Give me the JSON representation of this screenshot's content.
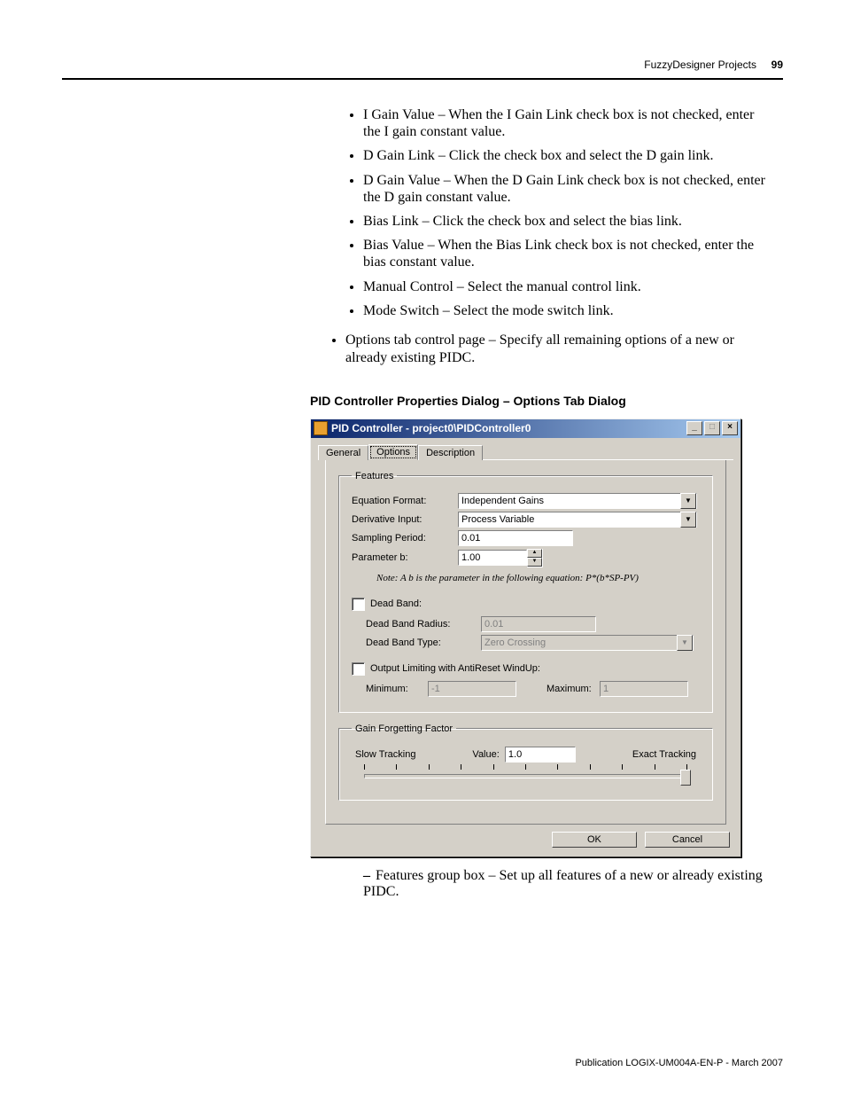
{
  "header": {
    "section": "FuzzyDesigner Projects",
    "page": "99"
  },
  "bullets": [
    "I Gain Value – When the I Gain Link check box is not checked, enter the I gain constant value.",
    "D Gain Link – Click the check box and select the D gain link.",
    "D Gain Value – When the D Gain Link check box is not checked, enter the D gain constant value.",
    "Bias Link – Click the check box and select the bias link.",
    "Bias Value – When the Bias Link check box is not checked, enter the bias constant value.",
    "Manual Control – Select the manual control link.",
    "Mode Switch – Select the mode switch link."
  ],
  "outer_bullet": "Options tab control page – Specify all remaining options of a new or already existing PIDC.",
  "section_title": "PID Controller Properties Dialog – Options Tab Dialog",
  "dialog": {
    "title": "PID Controller - project0\\PIDController0",
    "tabs": {
      "general": "General",
      "options": "Options",
      "description": "Description"
    },
    "features": {
      "legend": "Features",
      "equation_format_label": "Equation Format:",
      "equation_format": "Independent Gains",
      "derivative_input_label": "Derivative Input:",
      "derivative_input": "Process Variable",
      "sampling_period_label": "Sampling Period:",
      "sampling_period": "0.01",
      "parameter_b_label": "Parameter b:",
      "parameter_b": "1.00",
      "note": "Note: A b is the parameter in the following equation: P*(b*SP-PV)",
      "dead_band_label": "Dead Band:",
      "dead_band_radius_label": "Dead Band Radius:",
      "dead_band_radius": "0.01",
      "dead_band_type_label": "Dead Band Type:",
      "dead_band_type": "Zero Crossing",
      "output_limiting_label": "Output Limiting with AntiReset WindUp:",
      "minimum_label": "Minimum:",
      "minimum": "-1",
      "maximum_label": "Maximum:",
      "maximum": "1"
    },
    "gain": {
      "legend": "Gain Forgetting Factor",
      "slow": "Slow Tracking",
      "value_label": "Value:",
      "value": "1.0",
      "exact": "Exact Tracking"
    },
    "buttons": {
      "ok": "OK",
      "cancel": "Cancel"
    }
  },
  "after_dialog": "Features group box – Set up all features of a new or already existing PIDC.",
  "footer": "Publication LOGIX-UM004A-EN-P - March 2007"
}
